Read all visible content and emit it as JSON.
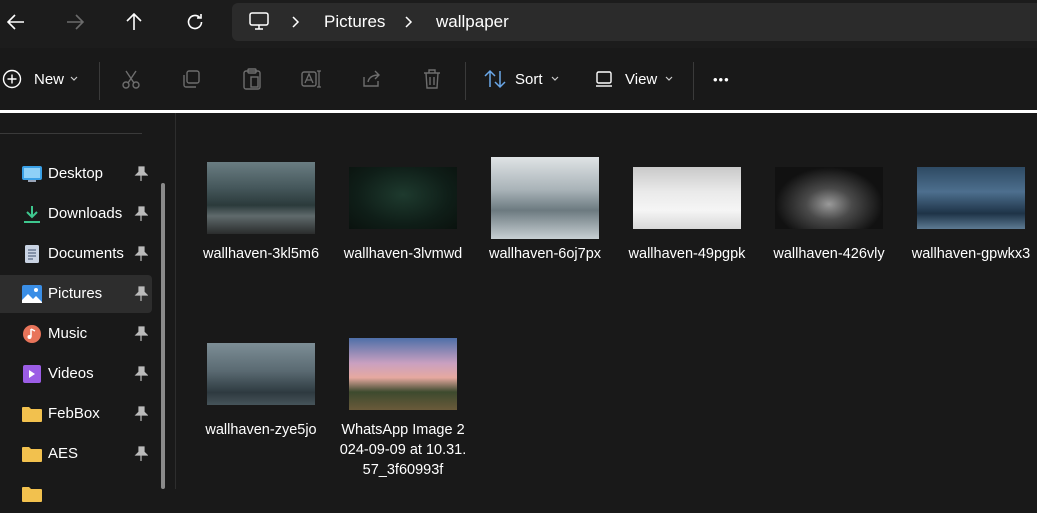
{
  "nav": {
    "back_icon": "arrow-left-icon",
    "forward_icon": "arrow-right-icon",
    "up_icon": "arrow-up-icon",
    "refresh_icon": "refresh-icon"
  },
  "address": {
    "icon": "monitor-icon",
    "crumbs": [
      "Pictures",
      "wallpaper"
    ]
  },
  "toolbar": {
    "new_label": "New",
    "sort_label": "Sort",
    "view_label": "View",
    "more_label": "•••"
  },
  "sidebar": {
    "items": [
      {
        "label": "Desktop",
        "icon": "desktop-icon",
        "color": "#3aa0e6"
      },
      {
        "label": "Downloads",
        "icon": "download-icon",
        "color": "#3ec78e"
      },
      {
        "label": "Documents",
        "icon": "document-icon",
        "color": "#9aa5b8"
      },
      {
        "label": "Pictures",
        "icon": "pictures-icon",
        "color": "#3a8ee6"
      },
      {
        "label": "Music",
        "icon": "music-icon",
        "color": "#e8745a"
      },
      {
        "label": "Videos",
        "icon": "videos-icon",
        "color": "#9b5de5"
      },
      {
        "label": "FebBox",
        "icon": "folder-icon",
        "color": "#f2c14e"
      },
      {
        "label": "AES",
        "icon": "folder-icon",
        "color": "#f2c14e"
      }
    ]
  },
  "files": [
    {
      "name": "wallhaven-3kl5m6"
    },
    {
      "name": "wallhaven-3lvmwd"
    },
    {
      "name": "wallhaven-6oj7px"
    },
    {
      "name": "wallhaven-49pgpk"
    },
    {
      "name": "wallhaven-426vly"
    },
    {
      "name": "wallhaven-gpwkx3"
    },
    {
      "name": "wallhaven-zye5jo"
    },
    {
      "name": "WhatsApp Image 2024-09-09 at 10.31.57_3f60993f"
    }
  ]
}
